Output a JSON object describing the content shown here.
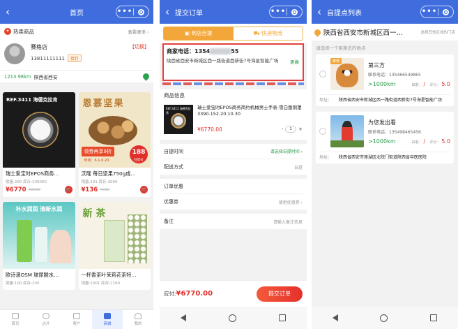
{
  "phone1": {
    "nav": {
      "back": "‹",
      "title": "首页",
      "dots": "•••"
    },
    "hot": {
      "title": "热卖商品",
      "more": "查看更多 ›"
    },
    "store": {
      "name": "赛格店",
      "phone": "13811111111",
      "tag": "接打",
      "switch": "【切换】"
    },
    "location": {
      "distance": "1213.98km",
      "address": "陕西省西安"
    },
    "products": [
      {
        "title": "瑞士爱宝时EPOS商务…",
        "meta": "销量:200  库存:100000",
        "price": "¥6770",
        "old": "¥8099",
        "image_text": "REF.3411 海德克拉肯"
      },
      {
        "title": "沃隆 每日坚果750g成…",
        "meta": "销量:101  库存:2099",
        "price": "¥136",
        "old": "¥239",
        "image_text": "恩慕坚果",
        "promo": "领券再享9折",
        "promo_date": "时间：6.1-6.20",
        "badge": "188",
        "badge_sub": "狂欢价"
      },
      {
        "title": "欧诗漫OSM 玻尿酸水…",
        "meta": "销量:100  库存:200",
        "price": "",
        "old": "",
        "image_text": "补水润润 清新水润"
      },
      {
        "title": "一杯香茶叶茉莉花茶特…",
        "meta": "销量:1001  库存:2199",
        "price": "",
        "old": "",
        "image_text": "新 茶"
      }
    ],
    "tabs": [
      {
        "label": "首页",
        "active": false
      },
      {
        "label": "达片",
        "active": false
      },
      {
        "label": "客户",
        "active": false
      },
      {
        "label": "商城",
        "active": true
      },
      {
        "label": "我的",
        "active": false
      }
    ]
  },
  "phone2": {
    "nav": {
      "back": "‹",
      "title": "提交订单",
      "dots": "•••"
    },
    "segment": {
      "pickup": "到店自提",
      "express": "快递物流"
    },
    "merchant": {
      "tel_label": "商家电话：",
      "tel_visible": "1354",
      "tel_end": "55",
      "address": "陕西省西安市新城区西一路街道西新街7号海星智能广场",
      "change": "更换"
    },
    "goods_section": "商品信息",
    "goods": {
      "name": "瑞士爱宝时EPOS商务简约机械男士手表-雪白版铜罩3390.152.20.10.30",
      "price": "¥6770.00",
      "qty": "1",
      "minus": "-",
      "plus": "+",
      "image_text": "REF.3411 海德克拉肯"
    },
    "rows": [
      {
        "label": "自提时间",
        "value": "请选择自提时间 ›",
        "green": true
      },
      {
        "label": "配送方式",
        "value": "自提",
        "green": false
      }
    ],
    "rows2": [
      {
        "label": "订单优惠",
        "value": "",
        "green": false
      },
      {
        "label": "优惠券",
        "value": "使用优惠券 ›",
        "green": false
      }
    ],
    "note": {
      "label": "备注",
      "value": "请输入备注信息"
    },
    "submit": {
      "label": "应付:",
      "amount": "¥6770.00",
      "button": "提交订单"
    }
  },
  "phone3": {
    "nav": {
      "back": "‹",
      "title": "自提点列表",
      "dots": "•••"
    },
    "search": {
      "city": "陕西省西安市新城区西一…",
      "hint": "选择其他区域的门店"
    },
    "near_label": "请选择一个距离近的地点",
    "points": [
      {
        "tag": "推荐",
        "name": "第三方",
        "tel": "联系电话：135466549865",
        "distance": ">1000km",
        "dist_label": "由客：",
        "slash": "/",
        "score_label": "评分：",
        "score": "5.0",
        "addr_label": "地址：",
        "addr": "陕西省西安市新城区西一路街道西新街7号海星智能广场"
      },
      {
        "tag": "",
        "name": "为您发出看",
        "tel": "联系电话：135498465456",
        "distance": ">1000km",
        "dist_label": "由客：",
        "slash": "/",
        "score_label": "评分：",
        "score": "5.0",
        "addr_label": "地址：",
        "addr": "陕西省西安市莲湖区北院门街道陕西省中医医院"
      }
    ]
  },
  "colors": {
    "primary": "#3f6dde",
    "accent": "#f3a73a",
    "price": "#e0302c",
    "green": "#2a9a4b"
  }
}
